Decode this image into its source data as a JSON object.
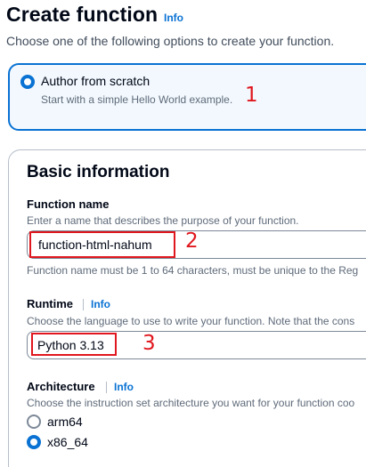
{
  "page": {
    "title": "Create function",
    "info": "Info",
    "subtitle": "Choose one of the following options to create your function."
  },
  "option": {
    "label": "Author from scratch",
    "description": "Start with a simple Hello World example.",
    "selected": true
  },
  "annotations": [
    "1",
    "2",
    "3"
  ],
  "annotation_color": "#e0171e",
  "accent_color": "#0972d3",
  "basic_info": {
    "title": "Basic information",
    "function_name": {
      "label": "Function name",
      "description": "Enter a name that describes the purpose of your function.",
      "value": "function-html-nahum",
      "hint": "Function name must be 1 to 64 characters, must be unique to the Reg"
    },
    "runtime": {
      "label": "Runtime",
      "info": "Info",
      "description": "Choose the language to use to write your function. Note that the cons",
      "value": "Python 3.13"
    },
    "architecture": {
      "label": "Architecture",
      "info": "Info",
      "description": "Choose the instruction set architecture you want for your function coo",
      "options": [
        "arm64",
        "x86_64"
      ],
      "selected": "x86_64"
    }
  }
}
